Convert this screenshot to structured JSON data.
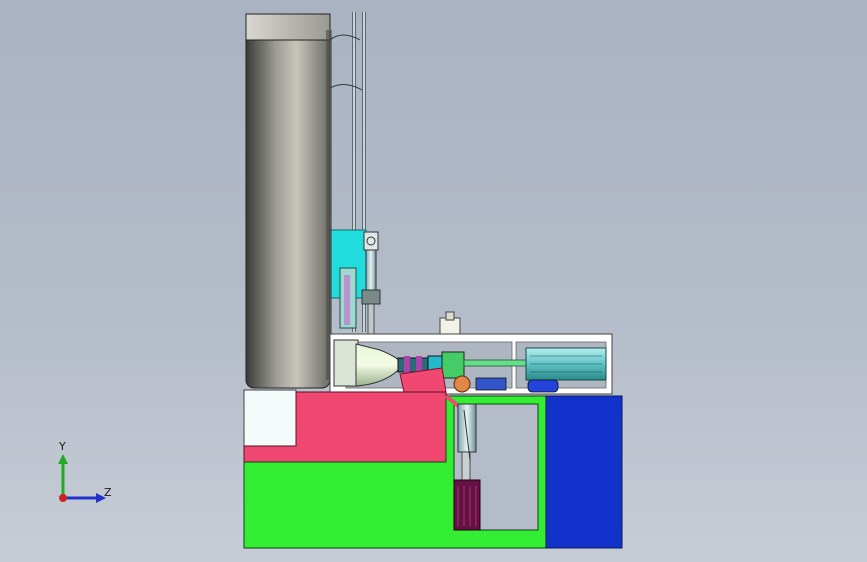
{
  "viewport": {
    "background_top": "#a9b3c2",
    "background_bottom": "#c7cdd6"
  },
  "triad": {
    "y_label": "Y",
    "z_label": "Z",
    "colors": {
      "y": "#22aa22",
      "z": "#2233cc",
      "origin": "#cc2222"
    }
  },
  "model_colors": {
    "drum": "#b4b4ac",
    "cyan_block": "#22dddd",
    "pink_plate": "#f04870",
    "green_base": "#33ee33",
    "blue_box": "#1133cc",
    "white_frame": "#ffffff",
    "teal_cylinder": "#66cccc",
    "purple_motor": "#661144"
  }
}
